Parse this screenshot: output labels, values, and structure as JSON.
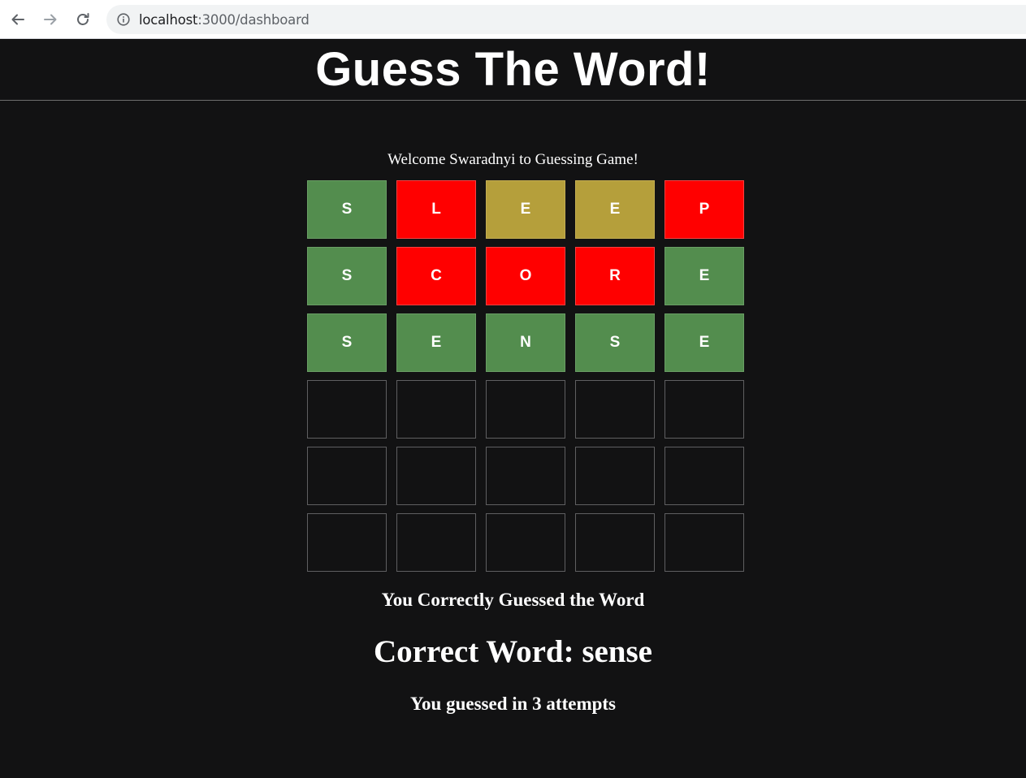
{
  "browser": {
    "url_host": "localhost",
    "url_path": ":3000/dashboard",
    "back_icon": "arrow-left-icon",
    "forward_icon": "arrow-right-icon",
    "reload_icon": "reload-icon",
    "info_icon": "info-circle-icon"
  },
  "page": {
    "title": "Guess The Word!",
    "welcome": "Welcome Swaradnyi to Guessing Game!"
  },
  "colors": {
    "correct": "#538d4e",
    "present": "#b59f3b",
    "absent": "#ff0000",
    "background": "#121213"
  },
  "board": {
    "rows": [
      [
        {
          "letter": "S",
          "state": "correct"
        },
        {
          "letter": "L",
          "state": "absent"
        },
        {
          "letter": "E",
          "state": "present"
        },
        {
          "letter": "E",
          "state": "present"
        },
        {
          "letter": "P",
          "state": "absent"
        }
      ],
      [
        {
          "letter": "S",
          "state": "correct"
        },
        {
          "letter": "C",
          "state": "absent"
        },
        {
          "letter": "O",
          "state": "absent"
        },
        {
          "letter": "R",
          "state": "absent"
        },
        {
          "letter": "E",
          "state": "correct"
        }
      ],
      [
        {
          "letter": "S",
          "state": "correct"
        },
        {
          "letter": "E",
          "state": "correct"
        },
        {
          "letter": "N",
          "state": "correct"
        },
        {
          "letter": "S",
          "state": "correct"
        },
        {
          "letter": "E",
          "state": "correct"
        }
      ],
      [
        {
          "letter": "",
          "state": "empty"
        },
        {
          "letter": "",
          "state": "empty"
        },
        {
          "letter": "",
          "state": "empty"
        },
        {
          "letter": "",
          "state": "empty"
        },
        {
          "letter": "",
          "state": "empty"
        }
      ],
      [
        {
          "letter": "",
          "state": "empty"
        },
        {
          "letter": "",
          "state": "empty"
        },
        {
          "letter": "",
          "state": "empty"
        },
        {
          "letter": "",
          "state": "empty"
        },
        {
          "letter": "",
          "state": "empty"
        }
      ],
      [
        {
          "letter": "",
          "state": "empty"
        },
        {
          "letter": "",
          "state": "empty"
        },
        {
          "letter": "",
          "state": "empty"
        },
        {
          "letter": "",
          "state": "empty"
        },
        {
          "letter": "",
          "state": "empty"
        }
      ]
    ]
  },
  "result": {
    "message": "You Correctly Guessed the Word",
    "correct_word": "Correct Word: sense",
    "attempts": "You guessed in 3 attempts"
  }
}
